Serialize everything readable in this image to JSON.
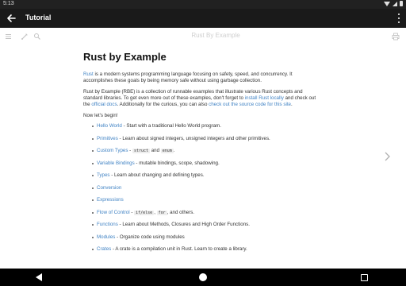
{
  "status_bar": {
    "time": "5:13",
    "icons": [
      "wifi-icon",
      "signal-icon",
      "battery-icon"
    ]
  },
  "app_bar": {
    "title": "Tutorial",
    "back_icon": "arrow-back-icon",
    "menu_icon": "overflow-menu-icon"
  },
  "book_toolbar": {
    "title": "Rust By Example",
    "icons": [
      "menu-icon",
      "brush-icon",
      "search-icon",
      "print-icon"
    ]
  },
  "page": {
    "heading": "Rust by Example",
    "intro": {
      "link": "Rust",
      "text": " is a modern systems programming language focusing on safety, speed, and concurrency. It accomplishes these goals by being memory safe without using garbage collection."
    },
    "rbe": {
      "t1": "Rust by Example (RBE) is a collection of runnable examples that illustrate various Rust concepts and standard libraries. To get even more out of these examples, don't forget to ",
      "l1": "install Rust locally",
      "t2": " and check out the ",
      "l2": "official docs",
      "t3": ". Additionally for the curious, you can also ",
      "l3": "check out the source code for this site",
      "t4": "."
    },
    "begin": "Now let's begin!",
    "topics": [
      {
        "link": "Hello World",
        "text": " - Start with a traditional Hello World program."
      },
      {
        "link": "Primitives",
        "text": " - Learn about signed integers, unsigned integers and other primitives."
      },
      {
        "link": "Custom Types",
        "text": " - ",
        "code1": "struct",
        "mid": " and ",
        "code2": "enum",
        "end": "."
      },
      {
        "link": "Variable Bindings",
        "text": " - mutable bindings, scope, shadowing."
      },
      {
        "link": "Types",
        "text": " - Learn about changing and defining types."
      },
      {
        "link": "Conversion",
        "text": ""
      },
      {
        "link": "Expressions",
        "text": ""
      },
      {
        "link": "Flow of Control",
        "text": " - ",
        "code1": "if/else",
        "mid": ", ",
        "code2": "for",
        "end": ", and others."
      },
      {
        "link": "Functions",
        "text": " - Learn about Methods, Closures and High Order Functions."
      },
      {
        "link": "Modules",
        "text": " - Organize code using modules"
      },
      {
        "link": "Crates",
        "text": " - A crate is a compilation unit in Rust. Learn to create a library."
      }
    ]
  },
  "next_icon": "chevron-right-icon",
  "nav_bar": {
    "icons": [
      "nav-back-icon",
      "nav-home-icon",
      "nav-recents-icon"
    ]
  },
  "colors": {
    "link": "#4183c4",
    "app_bar": "#1a1a1a",
    "status_bar": "#212121",
    "nav_bar": "#000000"
  }
}
